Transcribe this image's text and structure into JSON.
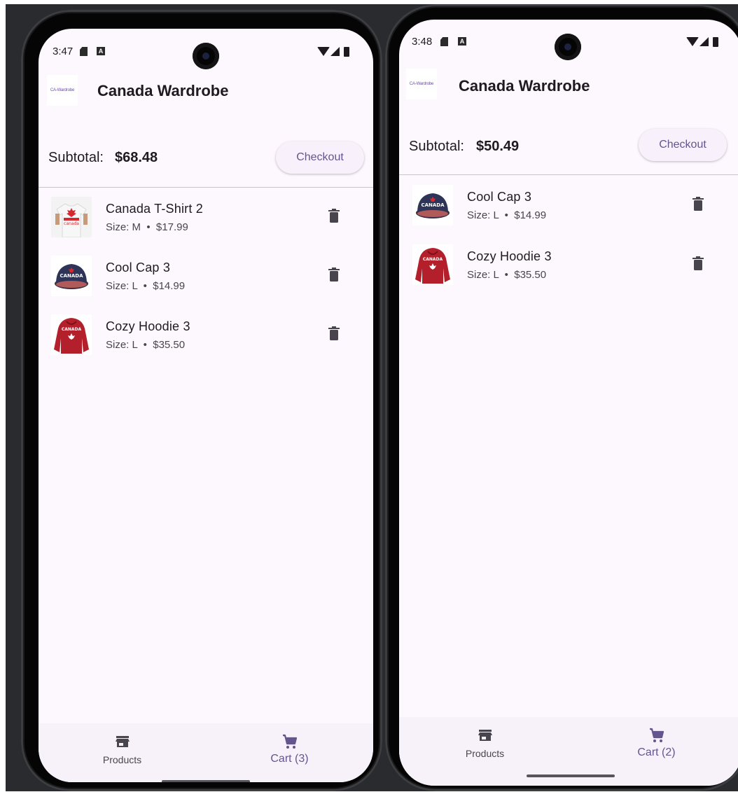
{
  "brand": {
    "accent": "#65558f",
    "surface": "#fdf7fe",
    "text": "#1d1b20"
  },
  "phones": [
    {
      "status": {
        "time": "3:47"
      },
      "app": {
        "logo_text": "CA-Wardrobe",
        "title": "Canada Wardrobe"
      },
      "subtotal": {
        "label": "Subtotal:",
        "value": "$68.48"
      },
      "checkout_label": "Checkout",
      "items": [
        {
          "name": "Canada T-Shirt 2",
          "meta": "Size: M  •  $17.99",
          "image": "tshirt",
          "thumb_text": "canada"
        },
        {
          "name": "Cool Cap 3",
          "meta": "Size: L  •  $14.99",
          "image": "cap",
          "thumb_text": "CANADA"
        },
        {
          "name": "Cozy Hoodie 3",
          "meta": "Size: L  •  $35.50",
          "image": "hoodie",
          "thumb_text": "CANADA"
        }
      ],
      "nav": [
        {
          "label": "Products",
          "icon": "store-icon",
          "active": false
        },
        {
          "label": "Cart (3)",
          "icon": "cart-icon",
          "active": true
        }
      ]
    },
    {
      "status": {
        "time": "3:48"
      },
      "app": {
        "logo_text": "CA-Wardrobe",
        "title": "Canada Wardrobe"
      },
      "subtotal": {
        "label": "Subtotal:",
        "value": "$50.49"
      },
      "checkout_label": "Checkout",
      "items": [
        {
          "name": "Cool Cap 3",
          "meta": "Size: L  •  $14.99",
          "image": "cap",
          "thumb_text": "CANADA"
        },
        {
          "name": "Cozy Hoodie 3",
          "meta": "Size: L  •  $35.50",
          "image": "hoodie",
          "thumb_text": "CANADA"
        }
      ],
      "nav": [
        {
          "label": "Products",
          "icon": "store-icon",
          "active": false
        },
        {
          "label": "Cart (2)",
          "icon": "cart-icon",
          "active": true
        }
      ]
    }
  ]
}
